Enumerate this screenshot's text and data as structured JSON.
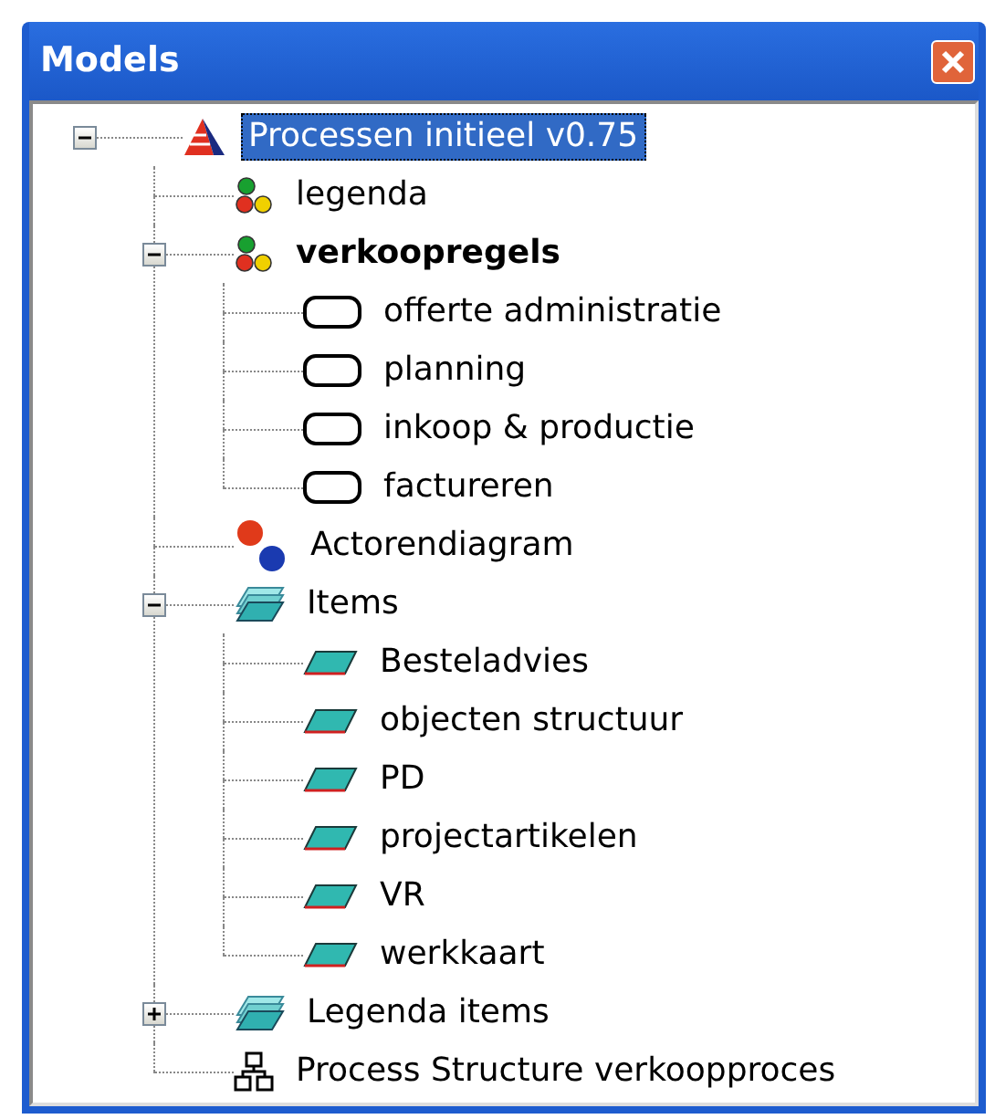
{
  "window": {
    "title": "Models"
  },
  "tree": [
    {
      "label": "Processen initieel v0.75",
      "kind": "model",
      "selected": true,
      "expanded": true,
      "children": [
        {
          "label": "legenda",
          "kind": "dots",
          "selected": false
        },
        {
          "label": "verkoopregels",
          "kind": "dots",
          "selected": false,
          "bold": true,
          "expanded": true,
          "children": [
            {
              "label": "offerte administratie",
              "kind": "process",
              "selected": false
            },
            {
              "label": "planning",
              "kind": "process",
              "selected": false
            },
            {
              "label": "inkoop & productie",
              "kind": "process",
              "selected": false
            },
            {
              "label": "factureren",
              "kind": "process",
              "selected": false
            }
          ]
        },
        {
          "label": "Actorendiagram",
          "kind": "actors",
          "selected": false
        },
        {
          "label": "Items",
          "kind": "itemgroup",
          "selected": false,
          "expanded": true,
          "children": [
            {
              "label": "Besteladvies",
              "kind": "item",
              "selected": false
            },
            {
              "label": "objecten structuur",
              "kind": "item",
              "selected": false
            },
            {
              "label": "PD",
              "kind": "item",
              "selected": false
            },
            {
              "label": "projectartikelen",
              "kind": "item",
              "selected": false
            },
            {
              "label": "VR",
              "kind": "item",
              "selected": false
            },
            {
              "label": "werkkaart",
              "kind": "item",
              "selected": false
            }
          ]
        },
        {
          "label": "Legenda items",
          "kind": "itemgroup",
          "selected": false,
          "expanded": false
        },
        {
          "label": "Process Structure verkoopproces",
          "kind": "structure",
          "selected": false
        }
      ]
    }
  ]
}
